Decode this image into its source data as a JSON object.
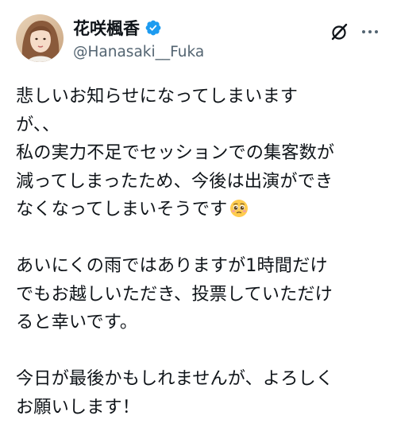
{
  "author": {
    "display_name": "花咲楓香",
    "handle": "@Hanasaki__Fuka",
    "verified": true
  },
  "icons": {
    "verified": "verified-badge-icon",
    "grok": "grok-slash-circle-icon",
    "more": "more-horizontal-icon",
    "emoji": "pleading-face-emoji"
  },
  "colors": {
    "text": "#0f1419",
    "secondary": "#536471",
    "verified_blue": "#1d9bf0"
  },
  "tweet": {
    "lines": [
      "悲しいお知らせになってしまいます",
      "が、、",
      "私の実力不足でセッションでの集客数が",
      "減ってしまったため、今後は出演ができ",
      "なくなってしまいそうです",
      "",
      "あいにくの雨ではありますが1時間だけ",
      "でもお越しいただき、投票していただけ",
      "ると幸いです。",
      "",
      "今日が最後かもしれませんが、よろしく",
      "お願いします！"
    ]
  }
}
